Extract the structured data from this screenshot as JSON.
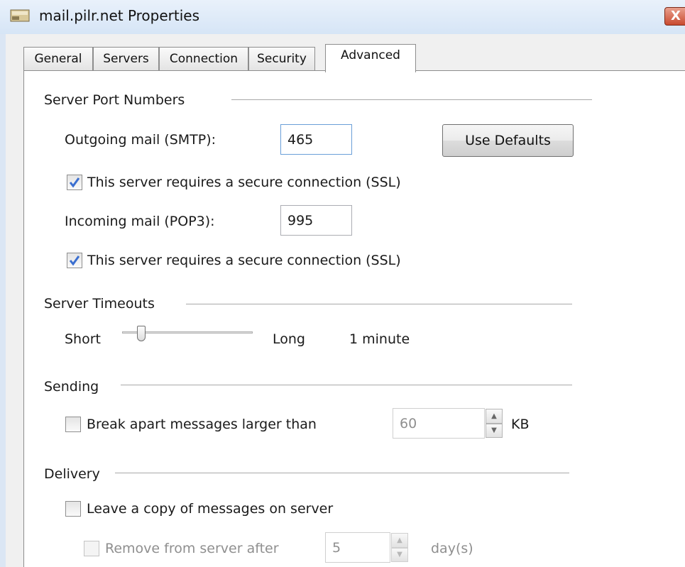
{
  "window": {
    "title": "mail.pilr.net Properties",
    "close_glyph": "X"
  },
  "tabs": [
    {
      "label": "General"
    },
    {
      "label": "Servers"
    },
    {
      "label": "Connection"
    },
    {
      "label": "Security"
    },
    {
      "label": "Advanced"
    }
  ],
  "active_tab": "Advanced",
  "ports": {
    "group_label": "Server Port Numbers",
    "smtp_label": "Outgoing mail (SMTP):",
    "smtp_value": "465",
    "defaults_button": "Use Defaults",
    "smtp_ssl_label": "This server requires a secure connection (SSL)",
    "smtp_ssl_checked": true,
    "pop3_label": "Incoming mail (POP3):",
    "pop3_value": "995",
    "pop3_ssl_label": "This server requires a secure connection (SSL)",
    "pop3_ssl_checked": true
  },
  "timeouts": {
    "group_label": "Server Timeouts",
    "short_label": "Short",
    "long_label": "Long",
    "value_text": "1 minute",
    "slider_level": 0.12
  },
  "sending": {
    "group_label": "Sending",
    "break_label": "Break apart messages larger than",
    "break_checked": false,
    "size_value": "60",
    "size_unit": "KB"
  },
  "delivery": {
    "group_label": "Delivery",
    "leave_copy_label": "Leave a copy of messages on server",
    "leave_copy_checked": false,
    "remove_label": "Remove from server after",
    "remove_checked": false,
    "days_value": "5",
    "days_unit": "day(s)"
  },
  "icons": {
    "title_icon": "mail-account-icon",
    "spin_up": "▲",
    "spin_down": "▼"
  },
  "colors": {
    "titlebar": "#dce8f6",
    "checkbox_tick": "#3b6fd0",
    "close_button": "#c94a2f"
  }
}
